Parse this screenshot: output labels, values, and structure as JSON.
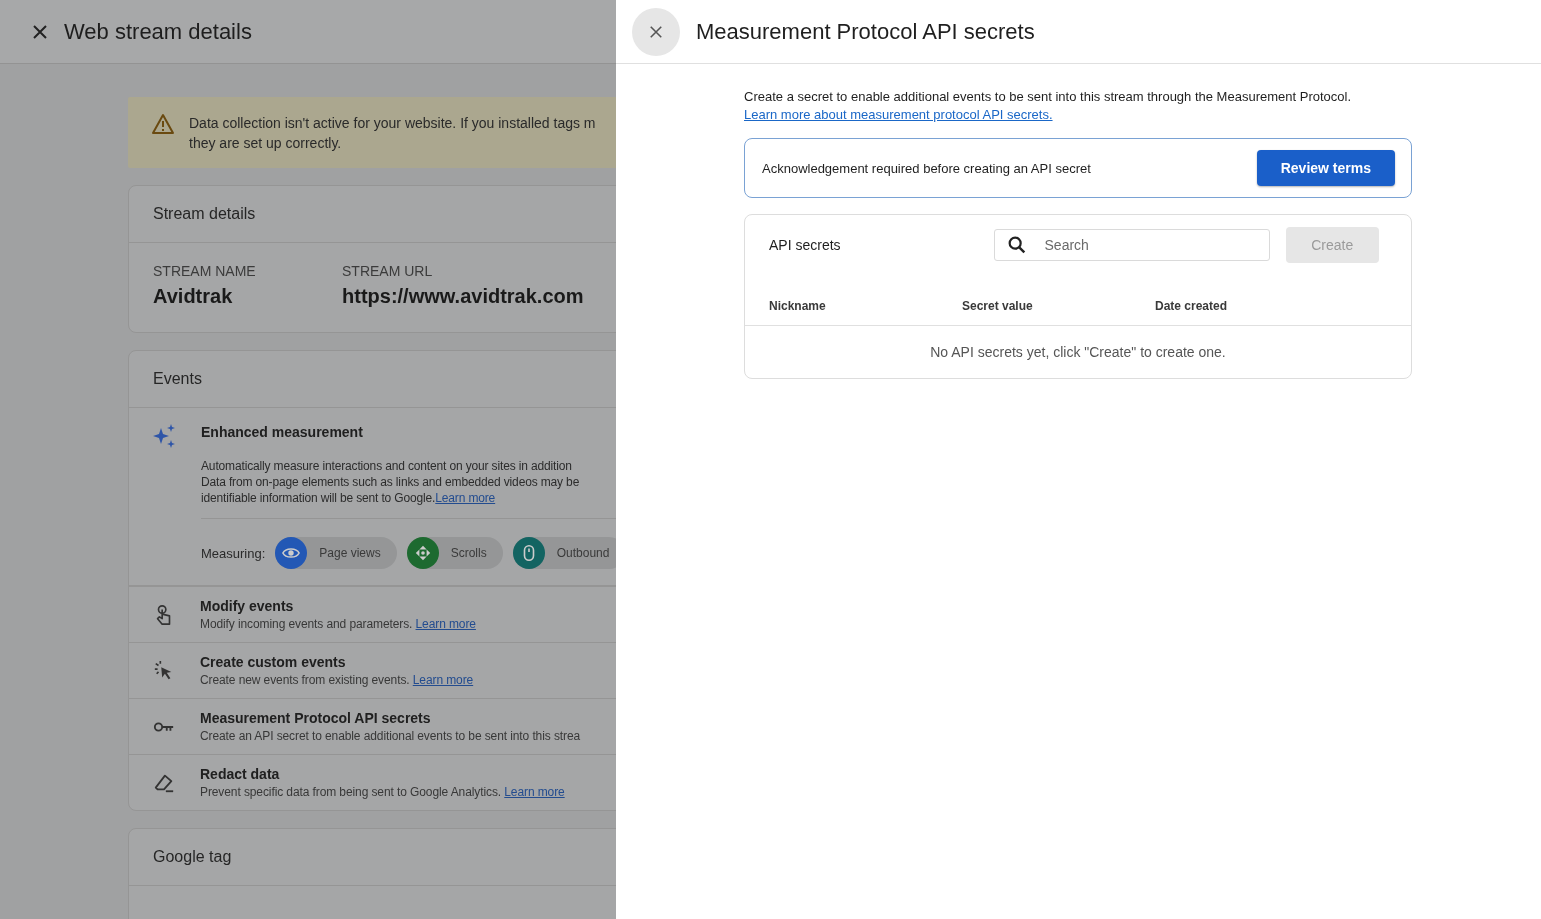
{
  "background_page": {
    "title": "Web stream details",
    "banner": {
      "lines": [
        "Data collection isn't active for your website. If you installed tags m",
        "they are set up correctly."
      ]
    },
    "stream_details": {
      "heading": "Stream details",
      "fields": [
        {
          "label": "STREAM NAME",
          "value": "Avidtrak"
        },
        {
          "label": "STREAM URL",
          "value": "https://www.avidtrak.com"
        }
      ]
    },
    "events": {
      "heading": "Events",
      "enhanced": {
        "title": "Enhanced measurement",
        "description_lines": [
          "Automatically measure interactions and content on your sites in addition",
          "Data from on-page elements such as links and embedded videos may be",
          "identifiable information will be sent to Google."
        ],
        "link": "Learn more",
        "measuring_label": "Measuring:",
        "chips": [
          {
            "kind": "eye",
            "label": "Page views",
            "color": "#2358b5"
          },
          {
            "kind": "scroll",
            "label": "Scrolls",
            "color": "#1d6a30"
          },
          {
            "kind": "mouse",
            "label": "Outbound",
            "color": "#136462"
          }
        ]
      },
      "items": [
        {
          "kind": "touch",
          "title": "Modify events",
          "description": "Modify incoming events and parameters.",
          "link": "Learn more"
        },
        {
          "kind": "cursor",
          "title": "Create custom events",
          "description": "Create new events from existing events.",
          "link": "Learn more"
        },
        {
          "kind": "key",
          "title": "Measurement Protocol API secrets",
          "description": "Create an API secret to enable additional events to be sent into this strea"
        },
        {
          "kind": "eraser",
          "title": "Redact data",
          "description": "Prevent specific data from being sent to Google Analytics.",
          "link": "Learn more"
        }
      ]
    },
    "google_tag": {
      "heading": "Google tag"
    }
  },
  "panel": {
    "title": "Measurement Protocol API secrets",
    "intro": "Create a secret to enable additional events to be sent into this stream through the Measurement Protocol.",
    "intro_link": "Learn more about measurement protocol API secrets.",
    "acknowledgement": {
      "text": "Acknowledgement required before creating an API secret",
      "button": "Review terms"
    },
    "secrets": {
      "heading": "API secrets",
      "search": {
        "placeholder": "Search"
      },
      "create": {
        "label": "Create",
        "disabled": true
      },
      "columns": [
        "Nickname",
        "Secret value",
        "Date created"
      ],
      "empty_message": "No API secrets yet, click \"Create\" to create one."
    }
  }
}
